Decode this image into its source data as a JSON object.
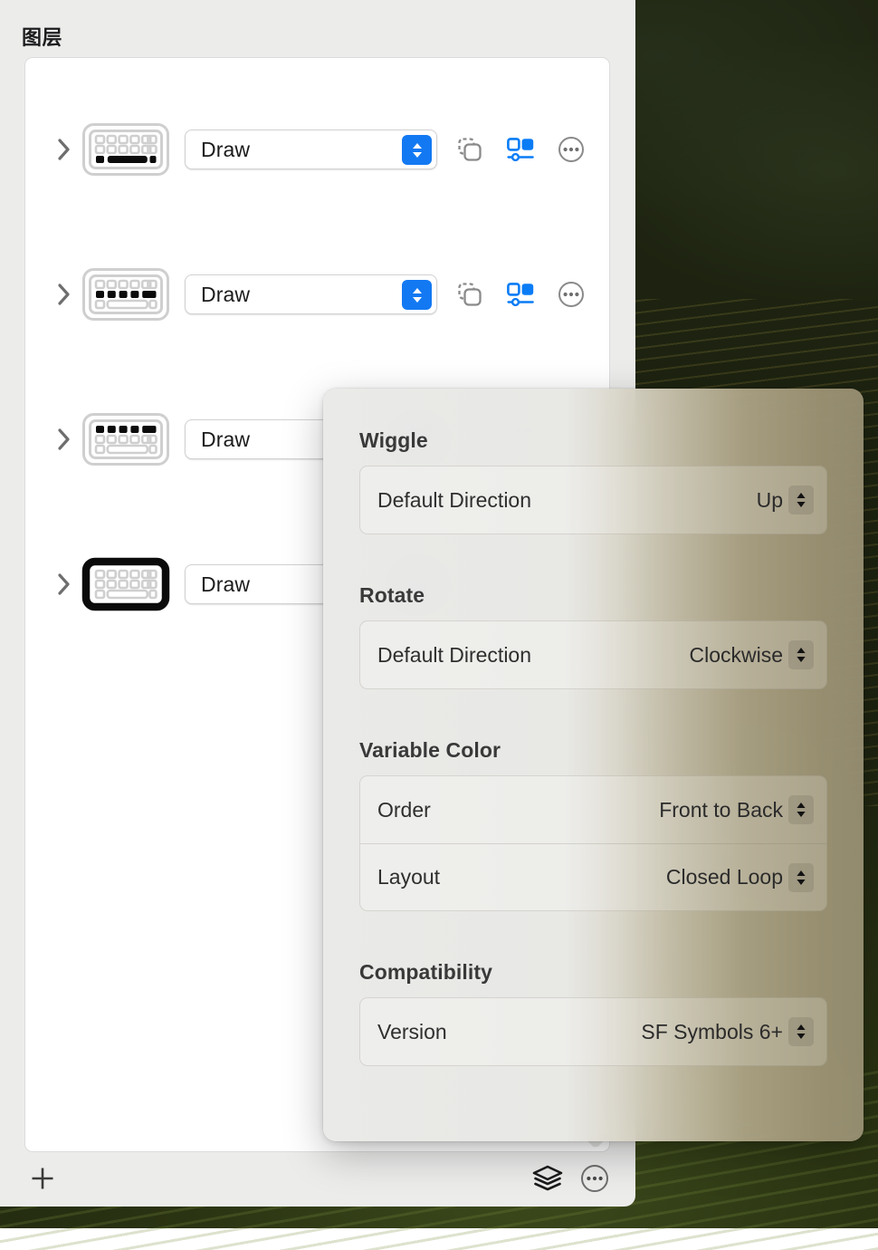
{
  "window": {
    "title": "图层",
    "layers": [
      {
        "keyboard_icon": "keyboard-spacebar-filled-icon",
        "action_label": "Draw",
        "selected": false
      },
      {
        "keyboard_icon": "keyboard-middle-row-filled-icon",
        "action_label": "Draw",
        "selected": false
      },
      {
        "keyboard_icon": "keyboard-top-row-filled-icon",
        "action_label": "Draw",
        "selected": false
      },
      {
        "keyboard_icon": "keyboard-outline-bold-icon",
        "action_label": "Draw",
        "selected": true
      }
    ],
    "row_actions": [
      {
        "name": "duplicate-icon",
        "label": "Duplicate"
      },
      {
        "name": "variable-color-icon",
        "label": "Variable Color"
      },
      {
        "name": "more-options-icon",
        "label": "More Options"
      }
    ],
    "bottom_bar": {
      "add_label": "+",
      "add_icon": "plus-icon",
      "layers_icon": "layers-stack-icon",
      "more_icon": "more-options-circle-icon"
    }
  },
  "popover": {
    "sections": [
      {
        "title": "Wiggle",
        "rows": [
          {
            "label": "Default Direction",
            "value": "Up"
          }
        ]
      },
      {
        "title": "Rotate",
        "rows": [
          {
            "label": "Default Direction",
            "value": "Clockwise"
          }
        ]
      },
      {
        "title": "Variable Color",
        "rows": [
          {
            "label": "Order",
            "value": "Front to Back"
          },
          {
            "label": "Layout",
            "value": "Closed Loop"
          }
        ]
      },
      {
        "title": "Compatibility",
        "rows": [
          {
            "label": "Version",
            "value": "SF Symbols 6+"
          }
        ]
      }
    ]
  },
  "colors": {
    "accent_blue": "#1379f3",
    "window_bg": "#ececeb",
    "list_bg": "#ffffff",
    "text_primary": "#1d1d1f"
  }
}
